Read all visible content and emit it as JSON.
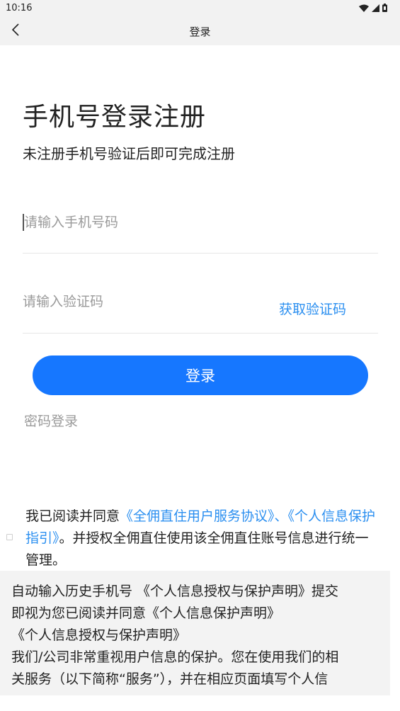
{
  "status_bar": {
    "time": "10:16",
    "icons": [
      "wifi-icon",
      "signal-icon",
      "battery-icon"
    ]
  },
  "nav": {
    "back_icon": "chevron-left-icon",
    "title": "登录"
  },
  "heading": {
    "title": "手机号登录注册",
    "subtitle": "未注册手机号验证后即可完成注册"
  },
  "form": {
    "phone_placeholder": "请输入手机号码",
    "code_placeholder": "请输入验证码",
    "get_code_label": "获取验证码",
    "login_label": "登录",
    "password_login_label": "密码登录"
  },
  "agreement": {
    "prefix": "我已阅读并同意",
    "service_agreement": "《全佣直住用户服务协议》",
    "separator": "、",
    "privacy_guide": "《个人信息保护指引》",
    "suffix": "。并授权全佣直住使用该全佣直住账号信息进行统一管理。"
  },
  "autofill_panel": {
    "lines": [
      "自动输入历史手机号 《个人信息授权与保护声明》提交",
      "即视为您已阅读并同意《个人信息保护声明》",
      "《个人信息授权与保护声明》",
      "我们/公司非常重视用户信息的保护。您在使用我们的相",
      "关服务（以下简称“服务”），并在相应页面填写个人信"
    ]
  },
  "colors": {
    "accent": "#1677ff",
    "link": "#2b8ff0",
    "placeholder": "#9a9a9a",
    "panel_bg": "#f3f3f3"
  }
}
